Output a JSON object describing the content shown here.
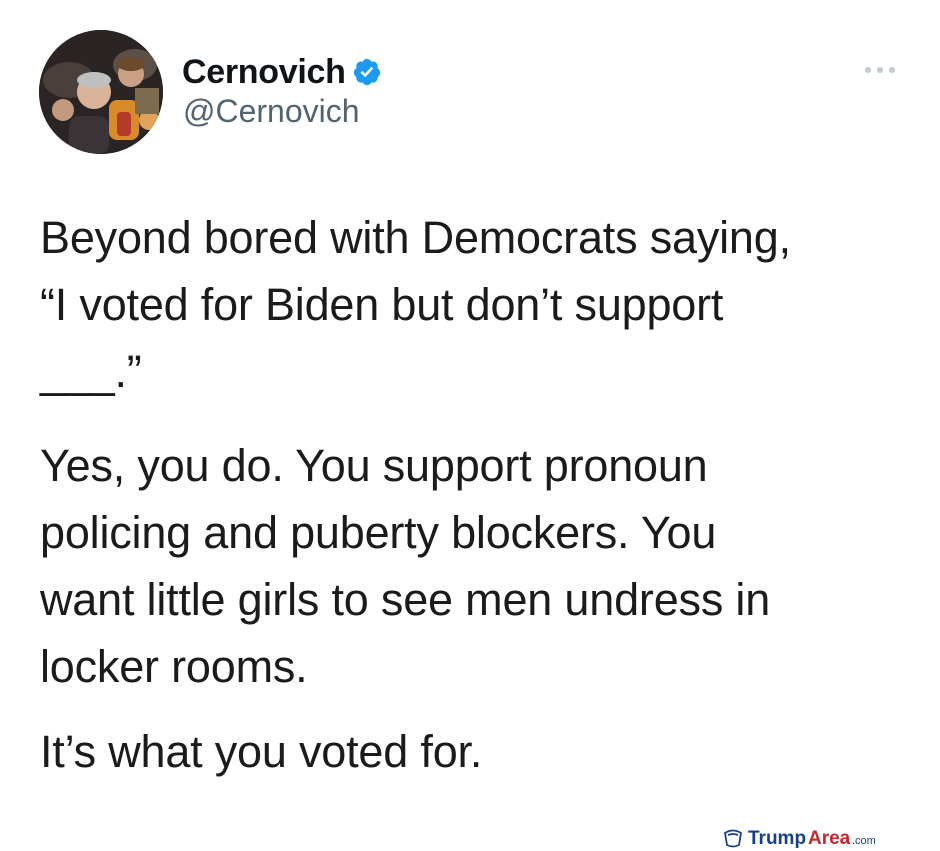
{
  "author": {
    "display_name": "Cernovich",
    "handle": "@Cernovich",
    "verified": true,
    "avatar_icon": "profile-photo",
    "verified_icon": "verified-badge-icon",
    "verified_color": "#1d9bf0"
  },
  "menu": {
    "icon": "more-options-icon"
  },
  "tweet": {
    "paragraphs": [
      "Beyond bored with Democrats saying,\n“I voted for Biden but don’t support\n___.”",
      "Yes, you do. You support pronoun\npolicing and puberty blockers. You\nwant little girls to see men undress in\nlocker rooms.",
      "It’s what you voted for."
    ]
  },
  "watermark": {
    "text": "TrumpArea.com",
    "colors": [
      "#1a3f8f",
      "#c8262b"
    ]
  }
}
